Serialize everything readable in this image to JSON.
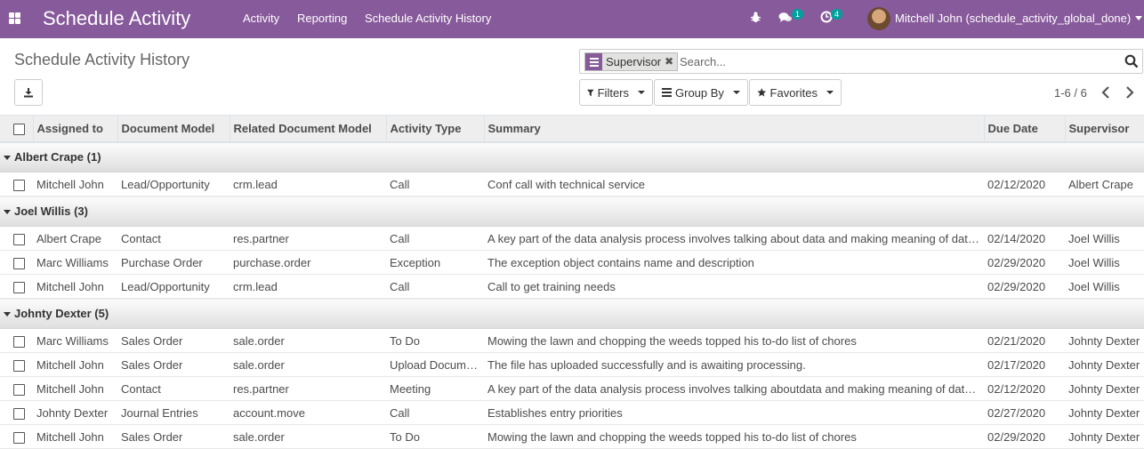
{
  "app": {
    "title": "Schedule Activity",
    "menu": [
      "Activity",
      "Reporting",
      "Schedule Activity History"
    ],
    "messages_count": "1",
    "activities_count": "4",
    "user_name": "Mitchell John (schedule_activity_global_done)",
    "accent_color": "#875a9b",
    "badge_color": "#00a09d"
  },
  "page": {
    "title": "Schedule Activity History",
    "search": {
      "facet_value": "Supervisor",
      "placeholder": "Search..."
    },
    "filters_label": "Filters",
    "groupby_label": "Group By",
    "favorites_label": "Favorites",
    "pager": "1-6 / 6"
  },
  "table": {
    "columns": [
      "Assigned to",
      "Document Model",
      "Related Document Model",
      "Activity Type",
      "Summary",
      "Due Date",
      "Supervisor"
    ],
    "groups": [
      {
        "label": "Albert Crape (1)",
        "rows": [
          [
            "Mitchell John",
            "Lead/Opportunity",
            "crm.lead",
            "Call",
            "Conf call with technical service",
            "02/12/2020",
            "Albert Crape"
          ]
        ]
      },
      {
        "label": "Joel Willis (3)",
        "rows": [
          [
            "Albert Crape",
            "Contact",
            "res.partner",
            "Call",
            "A key part of the data analysis process involves talking about data and making meaning of dat…",
            "02/14/2020",
            "Joel Willis"
          ],
          [
            "Marc Williams",
            "Purchase Order",
            "purchase.order",
            "Exception",
            "The exception object contains name and description",
            "02/29/2020",
            "Joel Willis"
          ],
          [
            "Mitchell John",
            "Lead/Opportunity",
            "crm.lead",
            "Call",
            "Call to get training needs",
            "02/29/2020",
            "Joel Willis"
          ]
        ]
      },
      {
        "label": "Johnty Dexter (5)",
        "rows": [
          [
            "Marc Williams",
            "Sales Order",
            "sale.order",
            "To Do",
            "Mowing the lawn and chopping the weeds topped his to-do list of chores",
            "02/21/2020",
            "Johnty Dexter"
          ],
          [
            "Mitchell John",
            "Sales Order",
            "sale.order",
            "Upload Document",
            "The file has uploaded successfully and is awaiting processing.",
            "02/17/2020",
            "Johnty Dexter"
          ],
          [
            "Mitchell John",
            "Contact",
            "res.partner",
            "Meeting",
            "A key part of the data analysis process involves talking aboutdata and making meaning of dat…",
            "02/12/2020",
            "Johnty Dexter"
          ],
          [
            "Johnty Dexter",
            "Journal Entries",
            "account.move",
            "Call",
            "Establishes entry priorities",
            "02/27/2020",
            "Johnty Dexter"
          ],
          [
            "Mitchell John",
            "Sales Order",
            "sale.order",
            "To Do",
            "Mowing the lawn and chopping the weeds topped his to-do list of chores",
            "02/29/2020",
            "Johnty Dexter"
          ]
        ]
      }
    ]
  }
}
